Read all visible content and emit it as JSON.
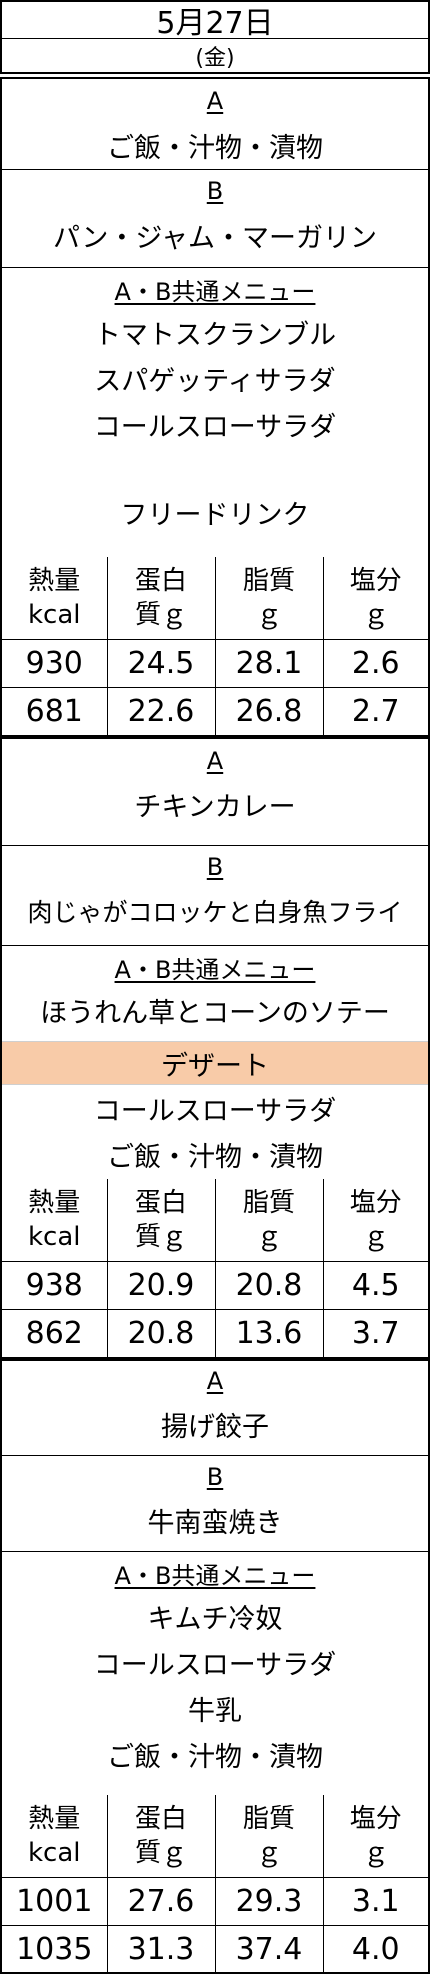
{
  "header": {
    "date": "5月27日",
    "weekday": "(金)"
  },
  "section_labels": {
    "a": "A",
    "b": "B",
    "common": "A・B共通メニュー",
    "dessert": "デザート"
  },
  "nutrition_headers": [
    {
      "line1": "熱量",
      "line2": "kcal"
    },
    {
      "line1": "蛋白",
      "line2": "質ｇ"
    },
    {
      "line1": "脂質",
      "line2": "ｇ"
    },
    {
      "line1": "塩分",
      "line2": "ｇ"
    }
  ],
  "breakfast": {
    "a": "ご飯・汁物・漬物",
    "b": "パン・ジャム・マーガリン",
    "common": [
      "トマトスクランブル",
      "スパゲッティサラダ",
      "コールスローサラダ",
      "フリードリンク"
    ],
    "nutrition": [
      [
        "930",
        "24.5",
        "28.1",
        "2.6"
      ],
      [
        "681",
        "22.6",
        "26.8",
        "2.7"
      ]
    ]
  },
  "lunch": {
    "a": "チキンカレー",
    "b": "肉じゃがコロッケと白身魚フライ",
    "common": [
      "ほうれん草とコーンのソテー"
    ],
    "dessert_items": [
      "コールスローサラダ",
      "ご飯・汁物・漬物"
    ],
    "nutrition": [
      [
        "938",
        "20.9",
        "20.8",
        "4.5"
      ],
      [
        "862",
        "20.8",
        "13.6",
        "3.7"
      ]
    ]
  },
  "dinner": {
    "a": "揚げ餃子",
    "b": "牛南蛮焼き",
    "common": [
      "キムチ冷奴",
      "コールスローサラダ",
      "牛乳",
      "ご飯・汁物・漬物"
    ],
    "nutrition": [
      [
        "1001",
        "27.6",
        "29.3",
        "3.1"
      ],
      [
        "1035",
        "31.3",
        "37.4",
        "4.0"
      ]
    ]
  }
}
